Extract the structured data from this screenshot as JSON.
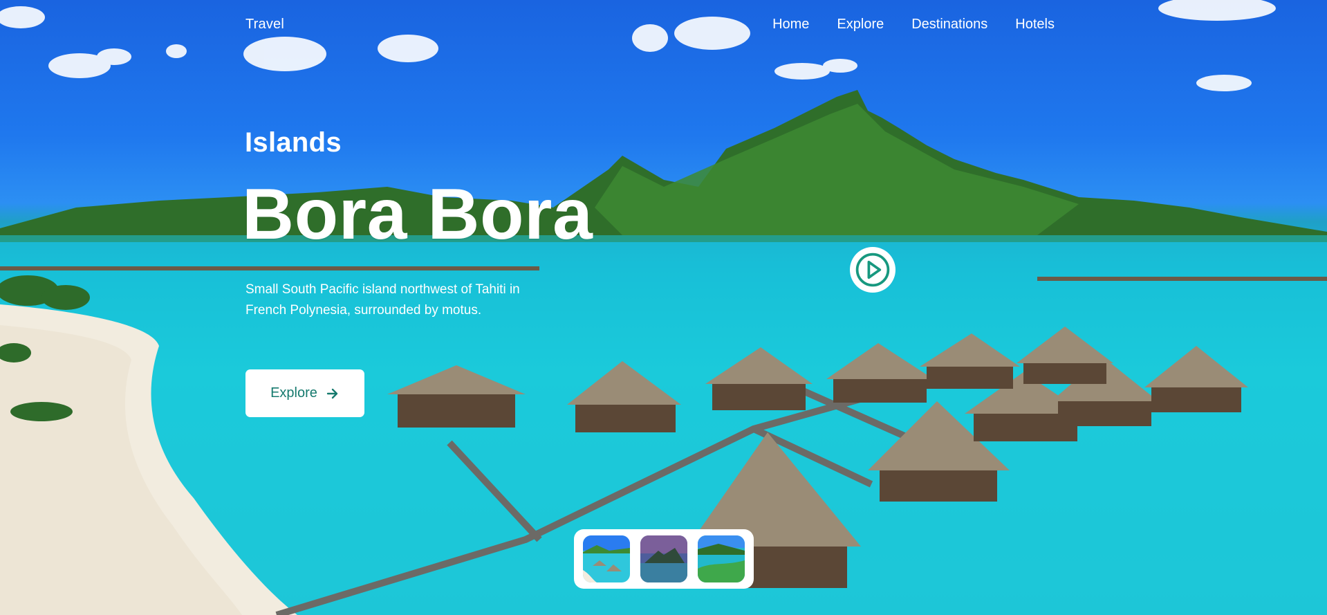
{
  "header": {
    "brand": "Travel",
    "nav": [
      "Home",
      "Explore",
      "Destinations",
      "Hotels"
    ]
  },
  "hero": {
    "subtitle": "Islands",
    "title": "Bora Bora",
    "description": "Small South Pacific island northwest of Tahiti in French Polynesia, surrounded by motus.",
    "explore_label": "Explore",
    "explore_icon": "arrow-right-icon",
    "play_icon": "play-circle-icon"
  },
  "thumbnails": [
    {
      "name": "overwater-bungalows-thumbnail",
      "active": true
    },
    {
      "name": "island-sunset-thumbnail",
      "active": false
    },
    {
      "name": "lagoon-thumbnail",
      "active": false
    }
  ],
  "colors": {
    "accent": "#167a6e",
    "sky": "#1f78ee",
    "lagoon": "#1dd0dc",
    "white": "#ffffff"
  }
}
